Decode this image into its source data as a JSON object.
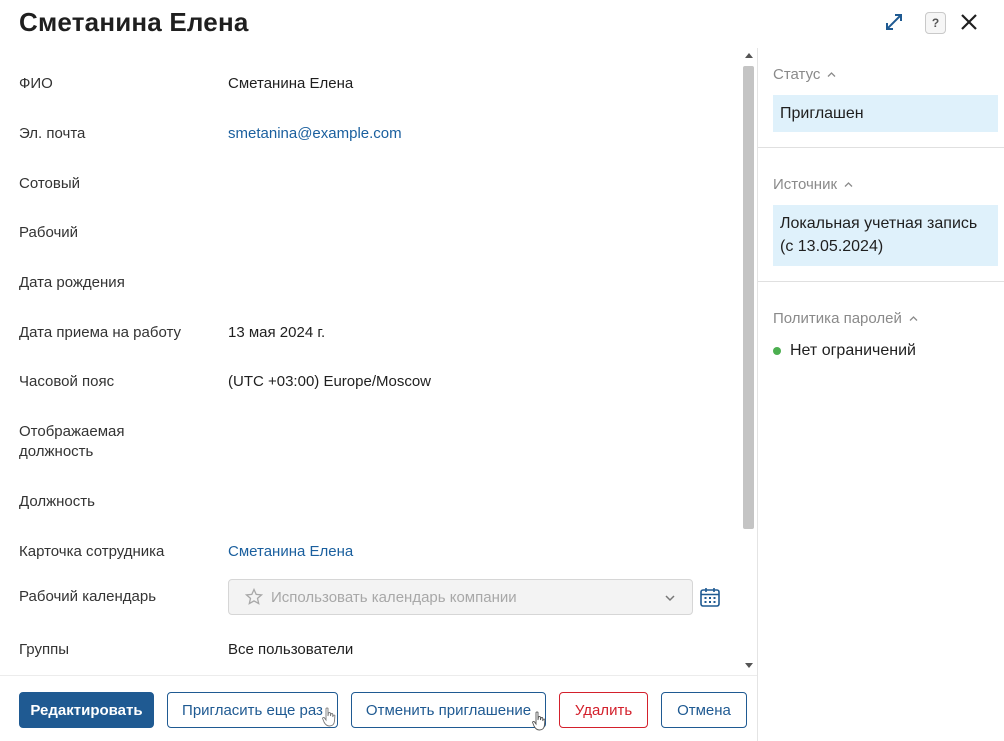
{
  "header": {
    "title": "Сметанина Елена",
    "help_label": "?"
  },
  "fields": [
    {
      "label": "ФИО",
      "value": "Сметанина Елена",
      "is_link": false
    },
    {
      "label": "Эл. почта",
      "value": "smetanina@example.com",
      "is_link": true
    },
    {
      "label": "Сотовый",
      "value": "",
      "is_link": false
    },
    {
      "label": "Рабочий",
      "value": "",
      "is_link": false
    },
    {
      "label": "Дата рождения",
      "value": "",
      "is_link": false
    },
    {
      "label": "Дата приема на работу",
      "value": "13 мая 2024 г.",
      "is_link": false
    },
    {
      "label": "Часовой пояс",
      "value": "(UTC +03:00) Europe/Moscow",
      "is_link": false
    },
    {
      "label": "Отображаемая должность",
      "value": "",
      "is_link": false
    },
    {
      "label": "Должность",
      "value": "",
      "is_link": false
    },
    {
      "label": "Карточка сотрудника",
      "value": "Сметанина Елена",
      "is_link": true
    },
    {
      "label": "Рабочий календарь",
      "value": "",
      "is_link": false
    },
    {
      "label": "Группы",
      "value": "Все пользователи",
      "is_link": false
    }
  ],
  "calendar_select": {
    "placeholder": "Использовать календарь компании"
  },
  "sidebar": {
    "status": {
      "heading": "Статус",
      "value": "Приглашен"
    },
    "source": {
      "heading": "Источник",
      "value": "Локальная учетная запись (с 13.05.2024)"
    },
    "password_policy": {
      "heading": "Политика паролей",
      "value": "Нет ограничений",
      "status_color": "#4caf50"
    }
  },
  "footer": {
    "edit_label": "Редактировать",
    "reinvite_label": "Пригласить еще раз",
    "cancel_invite_label": "Отменить приглашение",
    "delete_label": "Удалить",
    "cancel_label": "Отмена"
  },
  "colors": {
    "primary": "#1f5a92",
    "link": "#1a5f9e",
    "danger": "#d3202c",
    "highlight": "#dff1fb"
  }
}
